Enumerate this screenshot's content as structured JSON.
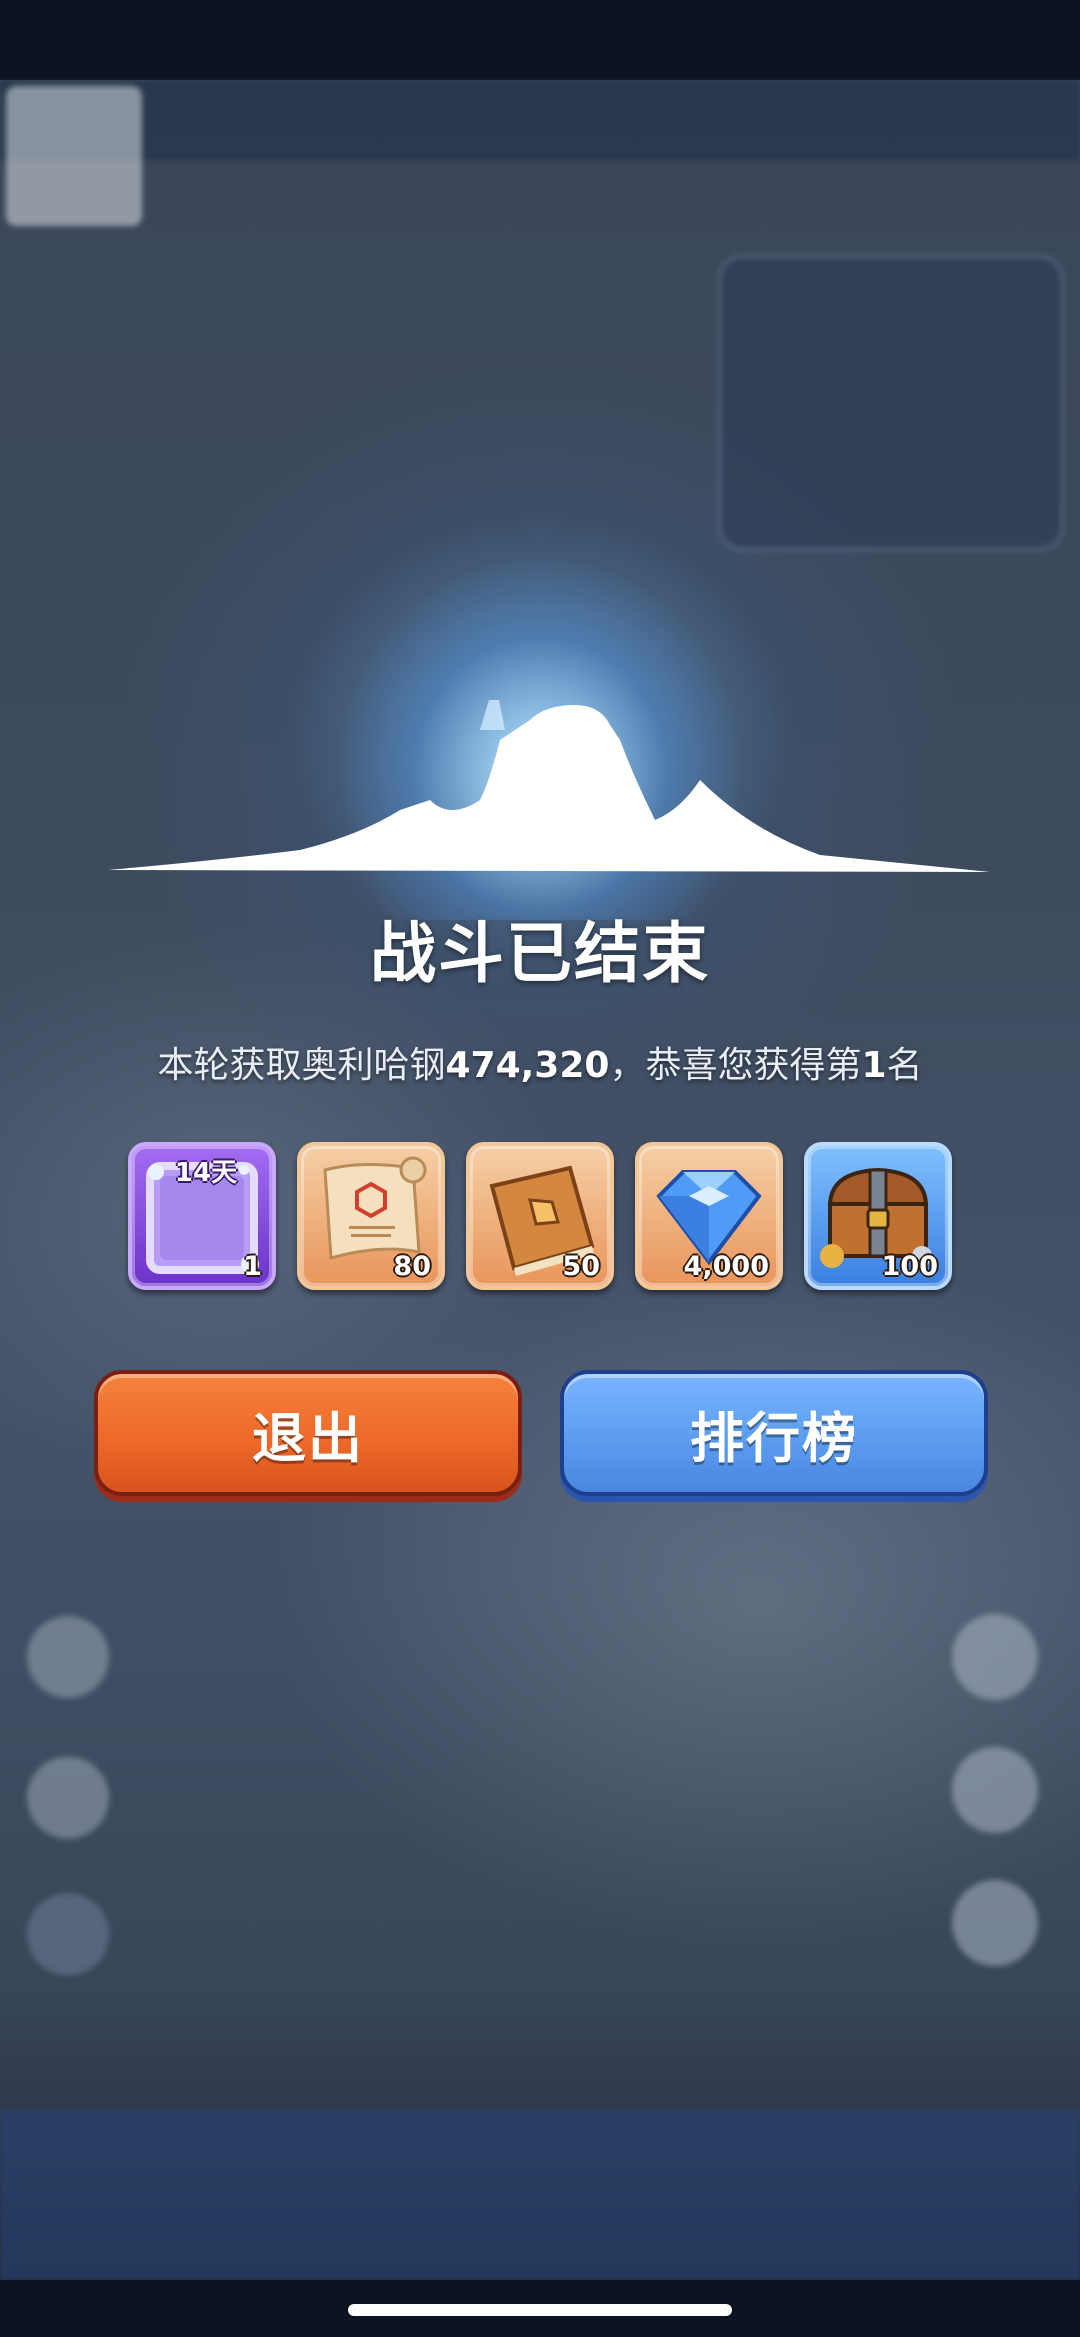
{
  "screen": {
    "title": "战斗已结束",
    "summary": {
      "prefix": "本轮获取奥利哈钢",
      "amount": "474,320",
      "middle": "，恭喜您获得第",
      "rank": "1",
      "suffix": "名"
    }
  },
  "rewards": [
    {
      "name": "avatar-frame",
      "icon": "frame-icon",
      "badge": "14天",
      "qty": "1"
    },
    {
      "name": "scroll",
      "icon": "scroll-icon",
      "qty": "80"
    },
    {
      "name": "book",
      "icon": "book-icon",
      "qty": "50"
    },
    {
      "name": "diamond",
      "icon": "diamond-icon",
      "qty": "4,000"
    },
    {
      "name": "chest",
      "icon": "chest-icon",
      "qty": "100"
    }
  ],
  "buttons": {
    "exit_label": "退出",
    "ranking_label": "排行榜"
  },
  "colors": {
    "exit": "#ee6a2a",
    "ranking": "#5c9df0",
    "title": "#ffffff"
  }
}
